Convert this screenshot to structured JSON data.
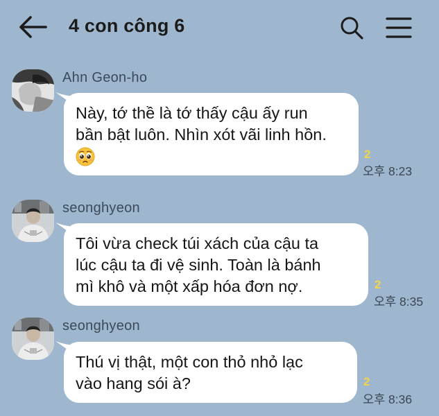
{
  "header": {
    "title": "4 con công 6"
  },
  "messages": [
    {
      "sender": "Ahn Geon-ho",
      "lines": [
        "Này, tớ thề là tớ thấy cậu ấy run",
        "bần bật luôn. Nhìn xót vãi linh hồn."
      ],
      "emoji": "pleading-face-emoji",
      "unread": "2",
      "time": "오후 8:23"
    },
    {
      "sender": "seonghyeon",
      "lines": [
        "Tôi vừa check túi xách của cậu ta",
        "lúc cậu ta đi vệ sinh. Toàn là bánh",
        "mì khô và một xấp hóa đơn nợ."
      ],
      "unread": "2",
      "time": "오후 8:35"
    },
    {
      "sender": "seonghyeon",
      "lines": [
        "Thú vị thật, một con thỏ nhỏ lạc",
        "vào hang sói à?"
      ],
      "unread": "2",
      "time": "오후 8:36"
    }
  ],
  "icons": {
    "back": "arrow-left-icon",
    "search": "search-icon",
    "menu": "hamburger-menu-icon"
  },
  "colors": {
    "background": "#9fb7ce",
    "bubble": "#ffffff",
    "unread": "#f2d34a"
  }
}
